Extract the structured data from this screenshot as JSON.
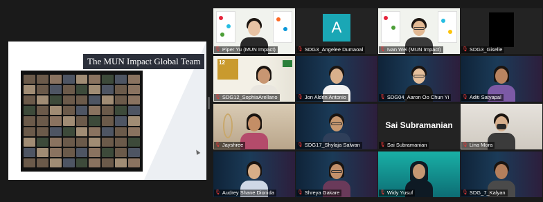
{
  "share": {
    "slide_title": "The MUN Impact Global Team"
  },
  "gallery": {
    "tiles": [
      {
        "name": "Piper Yu (MUN Impact)",
        "kind": "mun",
        "active": true
      },
      {
        "name": "SDG3_Angelee Dumaoal",
        "kind": "avatar",
        "avatar_letter": "A"
      },
      {
        "name": "Ivan Wei (MUN Impact)",
        "kind": "mun"
      },
      {
        "name": "SDG3_Giselle",
        "kind": "black"
      },
      {
        "name": "SDG12_SophiaArellano",
        "kind": "sdg"
      },
      {
        "name": "Jon Aldrin Antonio",
        "kind": "summit"
      },
      {
        "name": "SDG04_Aaron Oo Chun Yi",
        "kind": "summit"
      },
      {
        "name": "Aditi Satyapal",
        "kind": "summit"
      },
      {
        "name": "Jayshree",
        "kind": "room"
      },
      {
        "name": "SDG17_Shylaja Salwan",
        "kind": "summit"
      },
      {
        "name": "Sai Subramanian",
        "kind": "nameplate",
        "display_name": "Sai Subramanian"
      },
      {
        "name": "Lina Mora",
        "kind": "room"
      },
      {
        "name": "Audrey Shane Dionida",
        "kind": "summit"
      },
      {
        "name": "Shreya Gakare",
        "kind": "summit"
      },
      {
        "name": "Widy Yusuf",
        "kind": "green"
      },
      {
        "name": "SDG_7_Kalyan",
        "kind": "summit"
      }
    ]
  },
  "colors": {
    "active_border": "#e9e25a",
    "muted_mic": "#e53a3a",
    "avatar_bg": "#1aa7b5"
  },
  "icons": {
    "muted": "microphone-muted-icon"
  }
}
